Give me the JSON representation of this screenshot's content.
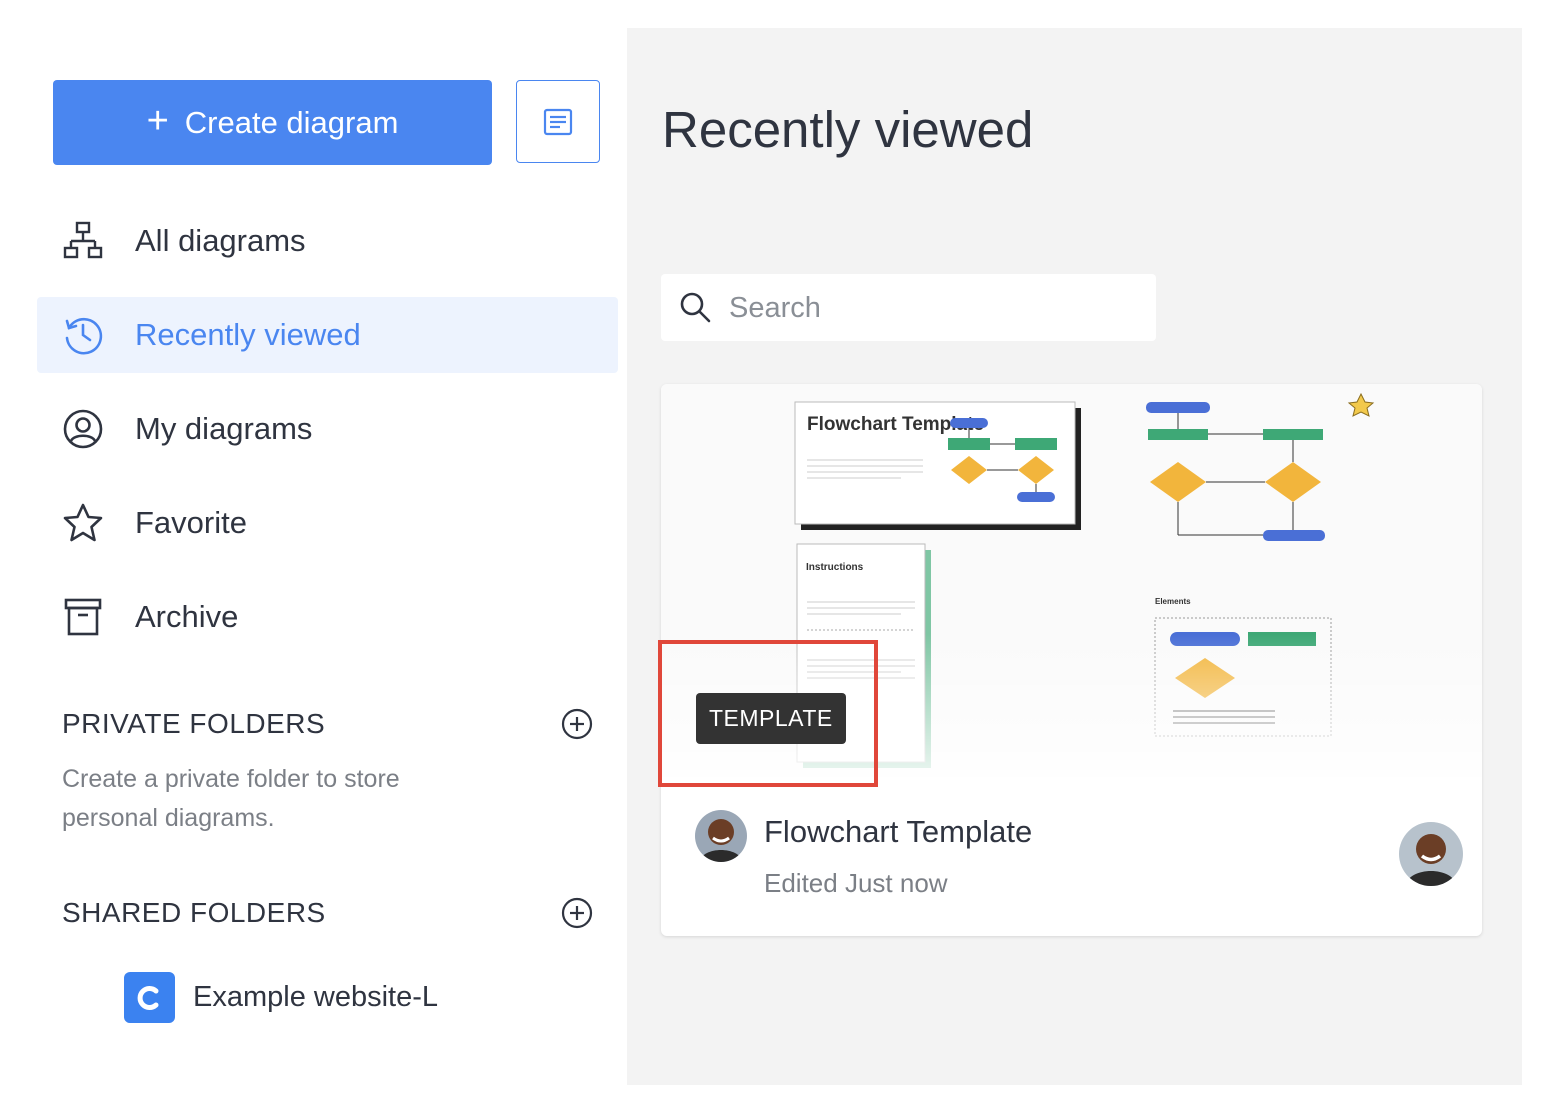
{
  "sidebar": {
    "create_label": "Create diagram",
    "nav": [
      {
        "label": "All diagrams",
        "icon": "hierarchy-icon"
      },
      {
        "label": "Recently viewed",
        "icon": "history-icon",
        "active": true
      },
      {
        "label": "My diagrams",
        "icon": "user-circle-icon"
      },
      {
        "label": "Favorite",
        "icon": "star-icon"
      },
      {
        "label": "Archive",
        "icon": "archive-icon"
      }
    ],
    "private_folders": {
      "title": "PRIVATE FOLDERS",
      "hint": "Create a private folder to store personal diagrams."
    },
    "shared_folders": {
      "title": "SHARED FOLDERS",
      "items": [
        {
          "label": "Example website-L",
          "badge_letter": "C"
        }
      ]
    }
  },
  "main": {
    "title": "Recently viewed",
    "search": {
      "placeholder": "Search",
      "value": ""
    },
    "cards": [
      {
        "badge": "TEMPLATE",
        "title": "Flowchart Template",
        "subtitle": "Edited Just now",
        "thumbnail": {
          "sheet_title": "Flowchart Template",
          "instructions_title": "Instructions",
          "elements_title": "Elements"
        }
      }
    ]
  },
  "colors": {
    "accent": "#4a86f0",
    "active_bg": "#edf3fe",
    "highlight": "#e0473a",
    "badge_bg": "#333333"
  }
}
